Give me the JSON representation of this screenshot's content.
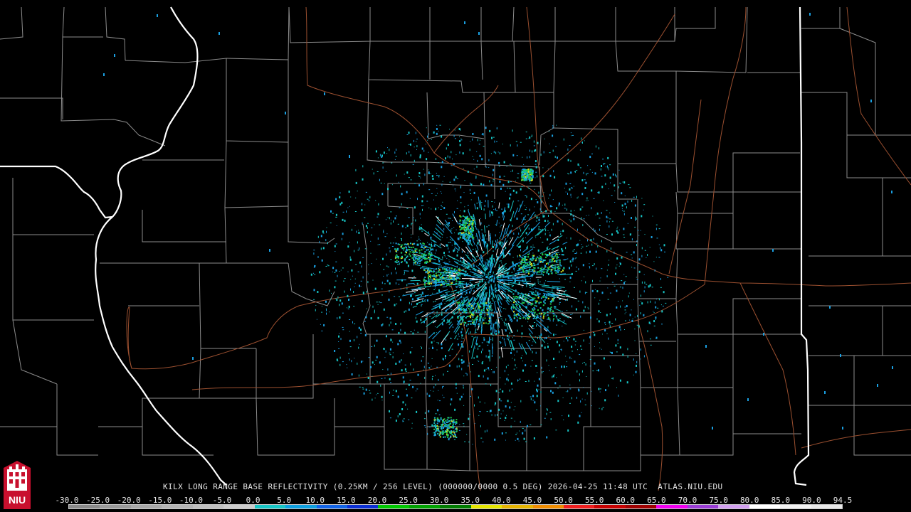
{
  "radar": {
    "caption": "KILX LONG RANGE BASE REFLECTIVITY (0.25KM / 256 LEVEL) (000000/0000 0.5 DEG) 2026-04-25 11:48 UTC  ATLAS.NIU.EDU",
    "station": "KILX",
    "product": "LONG RANGE BASE REFLECTIVITY",
    "resolution": "0.25KM / 256 LEVEL",
    "elevation": "0.5 DEG",
    "datetime": "2026-04-25 11:48 UTC",
    "source": "ATLAS.NIU.EDU"
  },
  "color_scale": {
    "labels": [
      "-30.0",
      "-25.0",
      "-20.0",
      "-15.0",
      "-10.0",
      "-5.0",
      "0.0",
      "5.0",
      "10.0",
      "15.0",
      "20.0",
      "25.0",
      "30.0",
      "35.0",
      "40.0",
      "45.0",
      "50.0",
      "55.0",
      "60.0",
      "65.0",
      "70.0",
      "75.0",
      "80.0",
      "85.0",
      "90.0",
      "94.5"
    ],
    "colors": [
      "#8a8a8a",
      "#9a9a9a",
      "#a8a8a8",
      "#b4b4b4",
      "#c0c0c0",
      "#cccccc",
      "#17c6c6",
      "#0ea0e0",
      "#1264e8",
      "#0a2fd6",
      "#00c800",
      "#00a200",
      "#007c00",
      "#e6e600",
      "#e6b400",
      "#f08c00",
      "#f01e1e",
      "#c80000",
      "#a00000",
      "#f000f0",
      "#9a3cd6",
      "#d2a0f0",
      "#ffffff",
      "#f2f2f2",
      "#e8e8e8"
    ]
  },
  "logo": {
    "text": "NIU",
    "color": "#c8102e"
  },
  "map_colors": {
    "state_border": "#ffffff",
    "county_line": "#9a9a9a",
    "highway": "#a0522d",
    "echo_weak": "#1a9fe0",
    "echo_moderate": "#17c6c6",
    "echo_strong": "#22c84a",
    "echo_peak": "#d8e020"
  }
}
